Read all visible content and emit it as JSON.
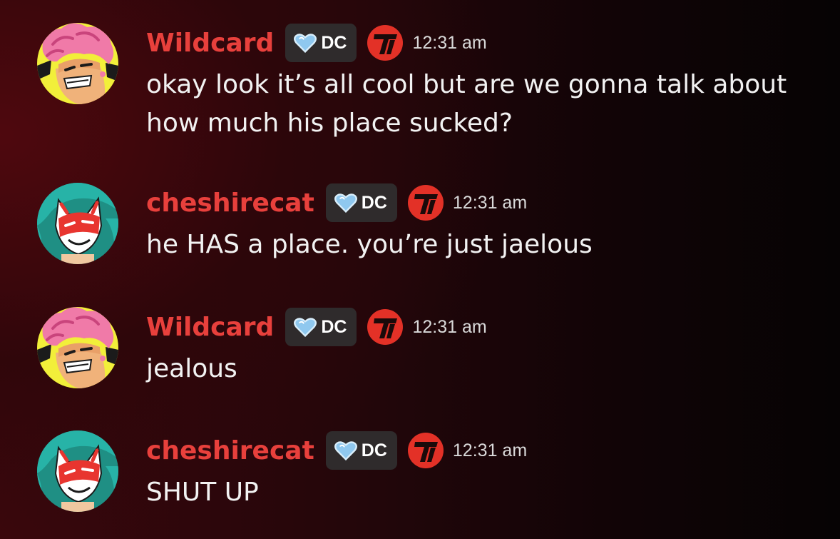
{
  "messages": [
    {
      "username": "Wildcard",
      "user_color": "#e8403c",
      "avatar_icon": "wildcard-avatar-icon",
      "tag": {
        "icon": "heart-icon",
        "label": "DC"
      },
      "badge_icon": "t-logo-badge-icon",
      "time": "12:31 am",
      "lines": [
        "okay look it’s all cool but are we gonna talk about",
        "how much his place sucked?"
      ]
    },
    {
      "username": "cheshirecat",
      "user_color": "#e8403c",
      "avatar_icon": "cheshirecat-avatar-icon",
      "tag": {
        "icon": "heart-icon",
        "label": "DC"
      },
      "badge_icon": "t-logo-badge-icon",
      "time": "12:31 am",
      "lines": [
        "he HAS a place. you’re just jaelous"
      ]
    },
    {
      "username": "Wildcard",
      "user_color": "#e8403c",
      "avatar_icon": "wildcard-avatar-icon",
      "tag": {
        "icon": "heart-icon",
        "label": "DC"
      },
      "badge_icon": "t-logo-badge-icon",
      "time": "12:31 am",
      "lines": [
        "jealous"
      ]
    },
    {
      "username": "cheshirecat",
      "user_color": "#e8403c",
      "avatar_icon": "cheshirecat-avatar-icon",
      "tag": {
        "icon": "heart-icon",
        "label": "DC"
      },
      "badge_icon": "t-logo-badge-icon",
      "time": "12:31 am",
      "lines": [
        "SHUT UP"
      ]
    }
  ]
}
